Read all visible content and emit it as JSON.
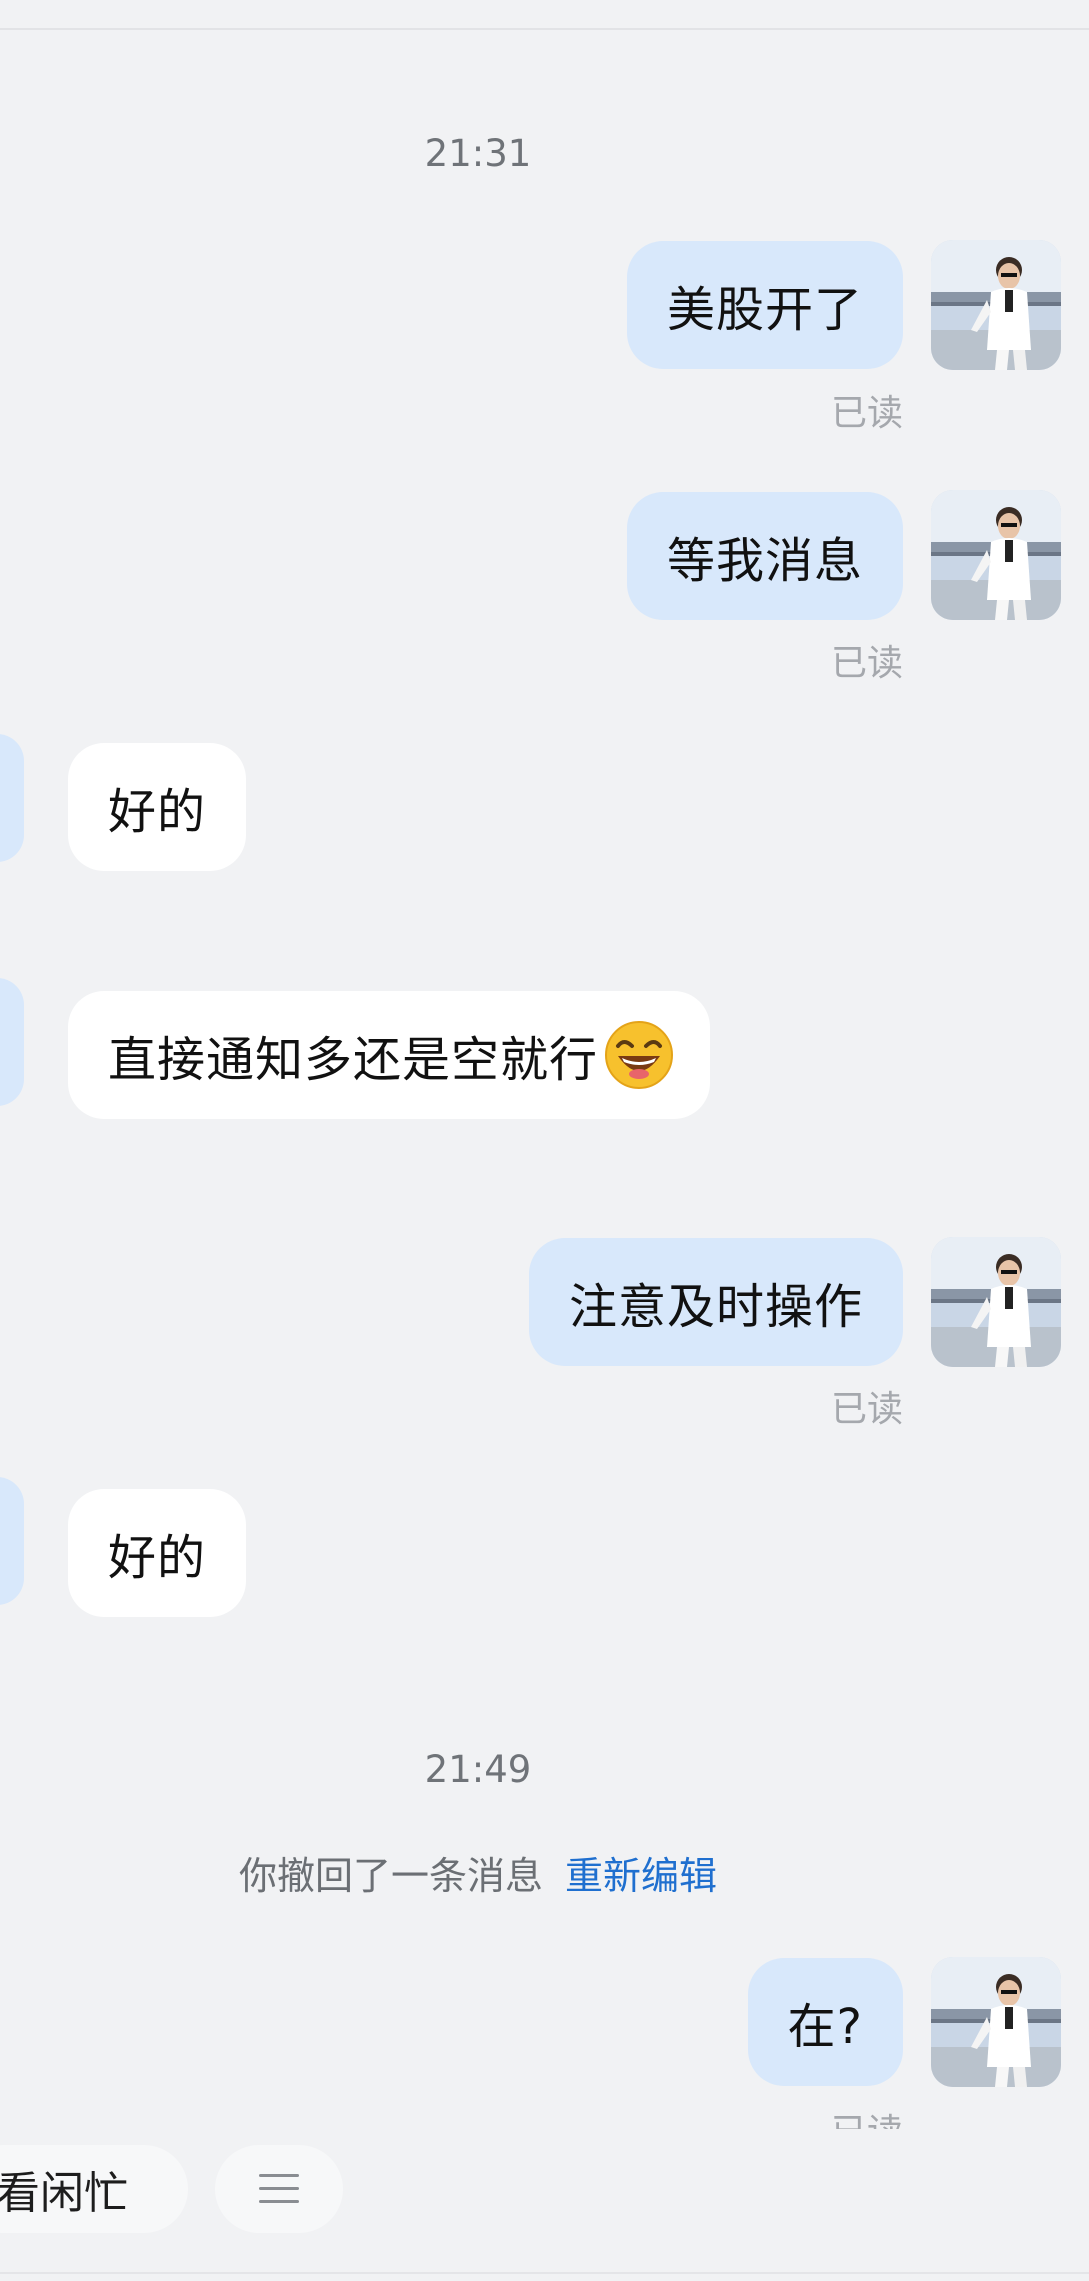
{
  "timestamps": [
    "21:31",
    "21:49"
  ],
  "messages": [
    {
      "text": "美股开了"
    },
    {
      "text": "等我消息"
    },
    {
      "text": "好的"
    },
    {
      "text": "直接通知多还是空就行"
    },
    {
      "text": "注意及时操作"
    },
    {
      "text": "好的"
    },
    {
      "text": "在?"
    }
  ],
  "read_receipt": "已读",
  "recall_notice": {
    "text": "你撤回了一条消息",
    "action": "重新编辑"
  },
  "quick_replies": {
    "chip1": "看闲忙",
    "menu_icon": "menu-lines-icon"
  },
  "colors": {
    "background": "#f1f2f4",
    "outgoing_bubble": "#d8e8fb",
    "incoming_bubble": "#ffffff",
    "link": "#1f6fcf",
    "read_text": "#a5a8ad"
  }
}
